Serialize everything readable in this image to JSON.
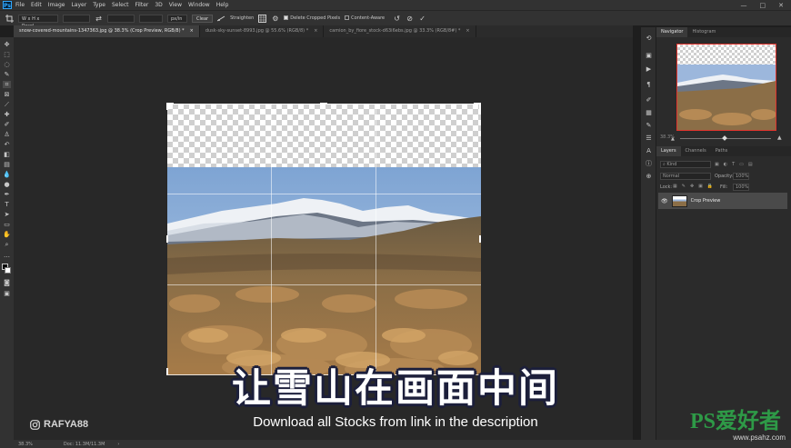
{
  "app": {
    "logo": "Ps"
  },
  "menu": [
    "File",
    "Edit",
    "Image",
    "Layer",
    "Type",
    "Select",
    "Filter",
    "3D",
    "View",
    "Window",
    "Help"
  ],
  "window_controls": [
    "—",
    "□",
    "✕"
  ],
  "options": {
    "ratio_select": "W x H x Resol...",
    "unit_value": "px/in",
    "clear_label": "Clear",
    "straighten_label": "Straighten",
    "delete_cropped_label": "Delete Cropped Pixels",
    "delete_cropped_checked": true,
    "content_aware_label": "Content-Aware",
    "content_aware_checked": false
  },
  "tabs": [
    {
      "label": "snow-covered-mountains-1347363.jpg @ 38.3% (Crop Preview, RGB/8) *",
      "active": true
    },
    {
      "label": "dusk-sky-sunset-8993.jpg @ 55.6% (RGB/8) *",
      "active": false
    },
    {
      "label": "camion_by_fiore_stock-d63i6ebs.jpg @ 33.3% (RGB/8#) *",
      "active": false
    }
  ],
  "navigator": {
    "tabs": [
      "Navigator",
      "Histogram"
    ],
    "zoom": "38.3%"
  },
  "layers": {
    "tabs": [
      "Layers",
      "Channels",
      "Paths"
    ],
    "filter_placeholder": "Kind",
    "blend_mode": "Normal",
    "opacity_label": "Opacity:",
    "opacity_value": "100%",
    "lock_label": "Lock:",
    "fill_label": "Fill:",
    "fill_value": "100%",
    "items": [
      {
        "name": "Crop Preview",
        "visible": true
      }
    ]
  },
  "status": {
    "zoom": "38.3%",
    "doc": "Doc: 11.3M/11.3M"
  },
  "overlay": {
    "subtitle_cn": "让雪山在画面中间",
    "subtitle_en": "Download all Stocks from link in the description",
    "instagram": "RAFYA88"
  },
  "watermark": {
    "logo": "PS爱好者",
    "url": "www.psahz.com"
  },
  "colors": {
    "accent_red": "#e0342d",
    "watermark_green": "#2e9a47",
    "ps_blue": "#31a8ff"
  }
}
